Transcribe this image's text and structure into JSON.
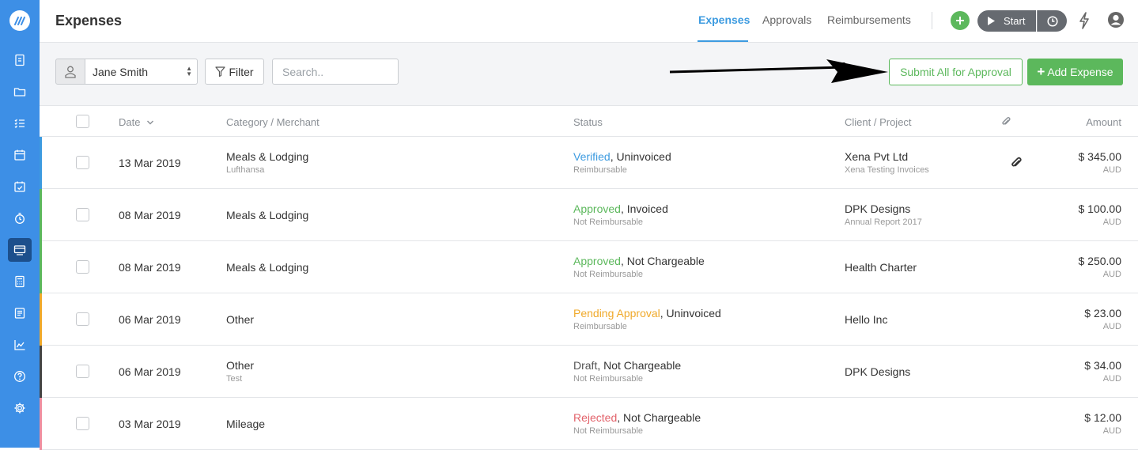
{
  "header": {
    "title": "Expenses",
    "tabs": [
      {
        "label": "Expenses",
        "active": true
      },
      {
        "label": "Approvals",
        "active": false
      },
      {
        "label": "Reimbursements",
        "active": false
      }
    ],
    "start_label": "Start",
    "accent_color": "#3d9be0"
  },
  "sidebar": {
    "items": [
      {
        "icon": "invoice-icon"
      },
      {
        "icon": "folder-icon"
      },
      {
        "icon": "task-list-icon"
      },
      {
        "icon": "calendar-icon"
      },
      {
        "icon": "calendar-check-icon"
      },
      {
        "icon": "timer-icon"
      },
      {
        "icon": "expenses-icon",
        "active": true
      },
      {
        "icon": "calculator-icon"
      },
      {
        "icon": "document-icon"
      },
      {
        "icon": "reports-chart-icon"
      },
      {
        "icon": "help-icon"
      },
      {
        "icon": "settings-gear-icon"
      }
    ],
    "color": "#3d8fe6"
  },
  "toolbar": {
    "user_selected": "Jane Smith",
    "filter_label": "Filter",
    "search_placeholder": "Search..",
    "submit_label": "Submit All for Approval",
    "add_label": "Add Expense"
  },
  "table": {
    "headers": {
      "date": "Date",
      "category": "Category / Merchant",
      "status": "Status",
      "client": "Client / Project",
      "amount": "Amount"
    },
    "rows": [
      {
        "date": "13 Mar 2019",
        "category": "Meals & Lodging",
        "merchant": "Lufthansa",
        "status": "Verified",
        "status_color": "#3d9be0",
        "status_rest": ", Uninvoiced",
        "reimb": "Reimbursable",
        "client": "Xena Pvt Ltd",
        "project": "Xena Testing Invoices",
        "attachment": true,
        "amount": "$ 345.00",
        "currency": "AUD",
        "stripe": "#3d9be0"
      },
      {
        "date": "08 Mar 2019",
        "category": "Meals & Lodging",
        "merchant": "",
        "status": "Approved",
        "status_color": "#5cb85c",
        "status_rest": ", Invoiced",
        "reimb": "Not Reimbursable",
        "client": "DPK Designs",
        "project": "Annual Report 2017",
        "attachment": false,
        "amount": "$ 100.00",
        "currency": "AUD",
        "stripe": "#5cb85c"
      },
      {
        "date": "08 Mar 2019",
        "category": "Meals & Lodging",
        "merchant": "",
        "status": "Approved",
        "status_color": "#5cb85c",
        "status_rest": ", Not Chargeable",
        "reimb": "Not Reimbursable",
        "client": "Health Charter",
        "project": "",
        "attachment": false,
        "amount": "$ 250.00",
        "currency": "AUD",
        "stripe": "#5cb85c"
      },
      {
        "date": "06 Mar 2019",
        "category": "Other",
        "merchant": "",
        "status": "Pending Approval",
        "status_color": "#f0a92a",
        "status_rest": ", Uninvoiced",
        "reimb": "Reimbursable",
        "client": "Hello Inc",
        "project": "",
        "attachment": false,
        "amount": "$ 23.00",
        "currency": "AUD",
        "stripe": "#f0a92a"
      },
      {
        "date": "06 Mar 2019",
        "category": "Other",
        "merchant": "Test",
        "status": "Draft",
        "status_color": "#555555",
        "status_rest": ", Not Chargeable",
        "reimb": "Not Reimbursable",
        "client": "DPK Designs",
        "project": "",
        "attachment": false,
        "amount": "$ 34.00",
        "currency": "AUD",
        "stripe": "#444444"
      },
      {
        "date": "03 Mar 2019",
        "category": "Mileage",
        "merchant": "",
        "status": "Rejected",
        "status_color": "#e2626a",
        "status_rest": ", Not Chargeable",
        "reimb": "Not Reimbursable",
        "client": "",
        "project": "",
        "attachment": false,
        "amount": "$ 12.00",
        "currency": "AUD",
        "stripe": "#ef8fa0"
      }
    ]
  }
}
